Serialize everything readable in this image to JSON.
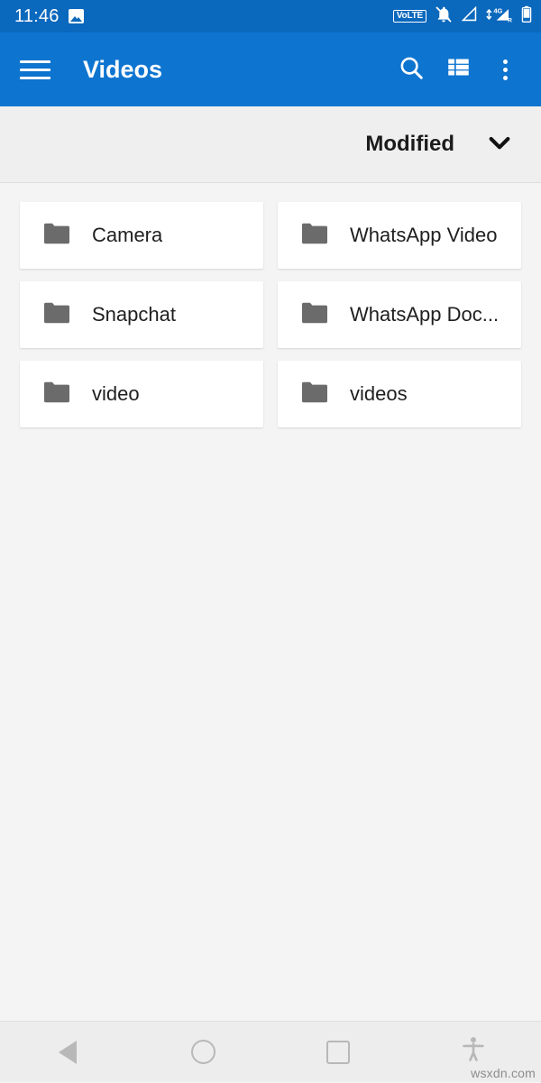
{
  "status_bar": {
    "time": "11:46",
    "left_icons": [
      {
        "name": "photo-icon"
      }
    ],
    "right_icons": [
      {
        "name": "volte-icon",
        "label": "VoLTE"
      },
      {
        "name": "notifications-muted-icon"
      },
      {
        "name": "signal-triangle-icon"
      },
      {
        "name": "mobile-data-4g-roaming-icon",
        "label": "4G",
        "roaming": "R"
      },
      {
        "name": "battery-icon"
      }
    ],
    "background_color": "#0a68bd"
  },
  "app_bar": {
    "title": "Videos",
    "menu_icon": "hamburger-menu-icon",
    "actions": [
      {
        "name": "search-icon"
      },
      {
        "name": "list-view-icon"
      },
      {
        "name": "overflow-menu-icon"
      }
    ],
    "background_color": "#0d74d0"
  },
  "sort_bar": {
    "label": "Modified",
    "chevron_icon": "chevron-down-icon",
    "background_color": "#efefef"
  },
  "folders": [
    {
      "name": "Camera",
      "icon": "folder-icon"
    },
    {
      "name": "WhatsApp Video",
      "icon": "folder-icon"
    },
    {
      "name": "Snapchat",
      "icon": "folder-icon"
    },
    {
      "name": "WhatsApp Doc...",
      "icon": "folder-icon"
    },
    {
      "name": "video",
      "icon": "folder-icon"
    },
    {
      "name": "videos",
      "icon": "folder-icon"
    }
  ],
  "nav_bar": {
    "buttons": [
      {
        "name": "back-button",
        "icon": "back-triangle-icon"
      },
      {
        "name": "home-button",
        "icon": "home-circle-icon"
      },
      {
        "name": "recents-button",
        "icon": "recents-square-icon"
      },
      {
        "name": "accessibility-button",
        "icon": "accessibility-icon"
      }
    ],
    "background_color": "#ededed"
  },
  "watermark": "wsxdn.com",
  "colors": {
    "accent": "#0d74d0",
    "status_bar": "#0a68bd",
    "page_background": "#f4f4f4",
    "card": "#ffffff",
    "folder_icon": "#6b6b6b",
    "nav_icon": "#b8b8b8"
  }
}
